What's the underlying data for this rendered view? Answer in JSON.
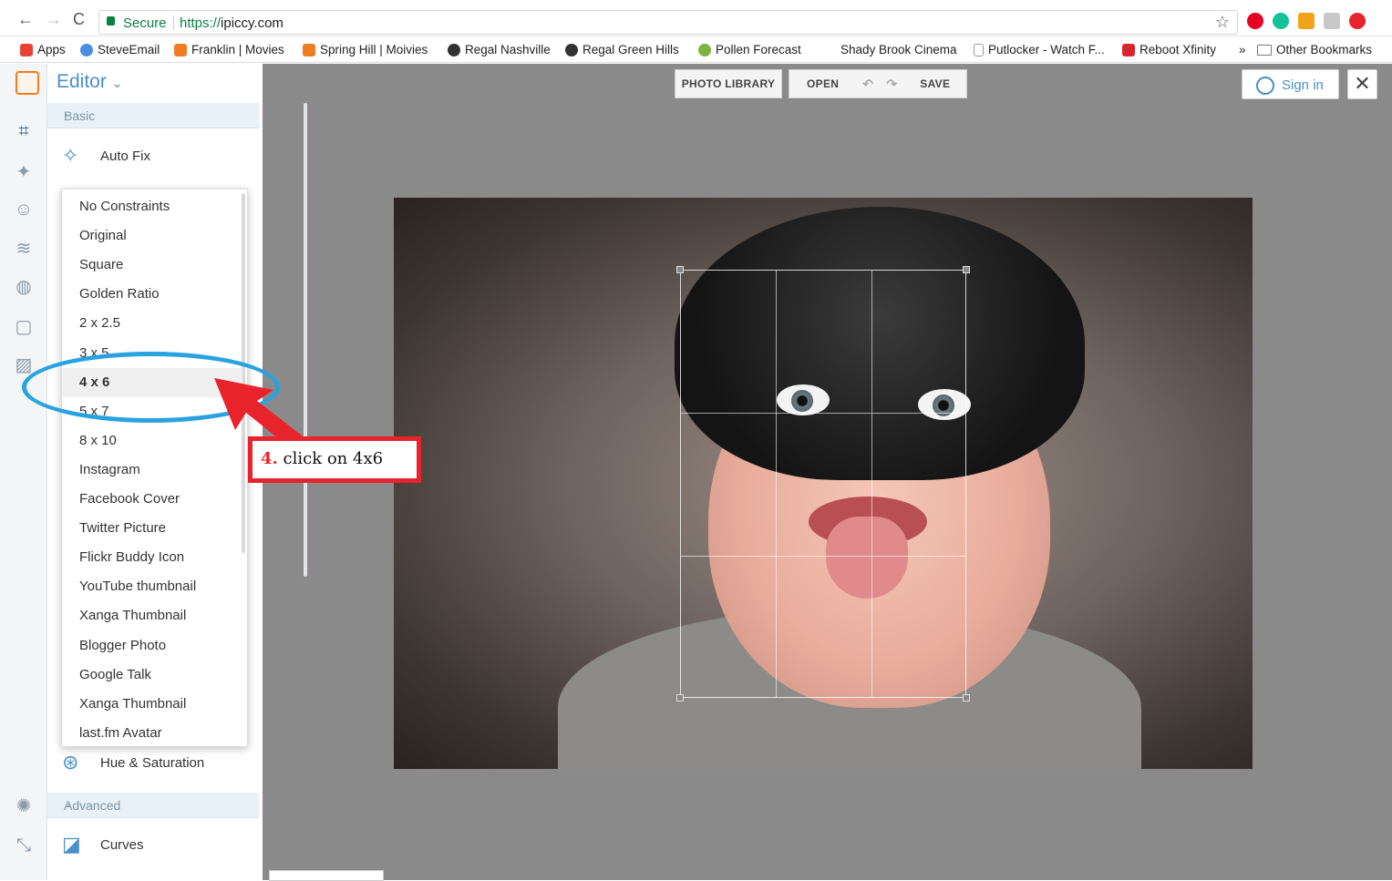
{
  "browser": {
    "secure_label": "Secure",
    "url_scheme": "https://",
    "url_rest": "ipiccy.com",
    "back": "←",
    "forward": "→",
    "reload": "C",
    "star": "☆"
  },
  "bookmarks": [
    {
      "label": "Apps",
      "icon": "apps-grid-icon",
      "color": "#e94235"
    },
    {
      "label": "SteveEmail",
      "icon": "globe-icon",
      "color": "#4a90e2"
    },
    {
      "label": "Franklin | Movies",
      "icon": "ticket-icon",
      "color": "#f07c22"
    },
    {
      "label": "Spring Hill | Moivies",
      "icon": "ticket-icon",
      "color": "#f07c22"
    },
    {
      "label": "Regal Nashville",
      "icon": "regal-icon",
      "color": "#333333"
    },
    {
      "label": "Regal Green Hills",
      "icon": "regal-icon",
      "color": "#333333"
    },
    {
      "label": "Pollen Forecast",
      "icon": "pollen-icon",
      "color": "#7cb342"
    },
    {
      "label": "Shady Brook Cinema",
      "icon": "none",
      "color": "#ffffff"
    },
    {
      "label": "Putlocker - Watch F...",
      "icon": "page-icon",
      "color": "#cccccc"
    },
    {
      "label": "Reboot Xfinity",
      "icon": "xfinity-icon",
      "color": "#d9262e"
    },
    {
      "label": "»",
      "icon": "none",
      "color": "#ffffff"
    },
    {
      "label": "Other Bookmarks",
      "icon": "folder-icon",
      "color": "#888888"
    }
  ],
  "editor": {
    "title": "Editor",
    "chevron": "⌄",
    "basic_section": "Basic",
    "advanced_section": "Advanced",
    "auto_fix": "Auto Fix",
    "hue_saturation": "Hue & Saturation",
    "curves": "Curves"
  },
  "crop_options": {
    "selected": "4 x 6",
    "items": [
      "No Constraints",
      "Original",
      "Square",
      "Golden Ratio",
      "2 x 2.5",
      "3 x 5",
      "4 x 6",
      "5 x 7",
      "8 x 10",
      "Instagram",
      "Facebook Cover",
      "Twitter Picture",
      "Flickr Buddy Icon",
      "YouTube thumbnail",
      "Xanga Thumbnail",
      "Blogger Photo",
      "Google Talk",
      "Xanga Thumbnail",
      "last.fm Avatar"
    ]
  },
  "toolbar": {
    "photo_library": "PHOTO LIBRARY",
    "open": "OPEN",
    "save": "SAVE",
    "sign_in": "Sign in",
    "close": "✕"
  },
  "annotation": {
    "step": "4.",
    "text": "click on 4x6"
  },
  "colors": {
    "accent": "#4a90c7",
    "annotation_red": "#e8232b",
    "annotation_blue": "#29a3e0"
  }
}
